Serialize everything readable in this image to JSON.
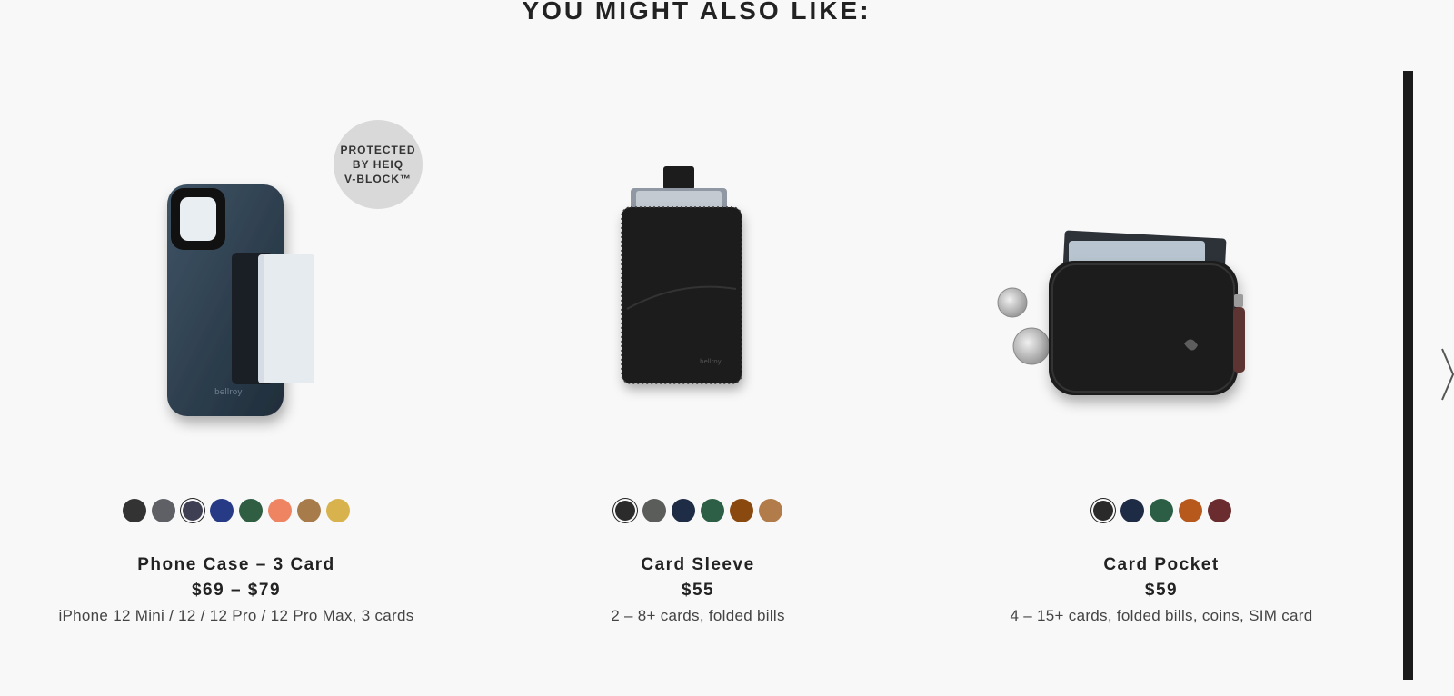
{
  "section": {
    "title": "YOU MIGHT ALSO LIKE:"
  },
  "products": [
    {
      "name": "Phone Case – 3 Card",
      "price": "$69 – $79",
      "description": "iPhone 12 Mini / 12 / 12 Pro / 12 Pro Max, 3 cards",
      "badge": "PROTECTED\nBY HEIQ\nV-BLOCK™",
      "swatches": [
        "#333333",
        "#5f6066",
        "#3e3f52",
        "#263a86",
        "#2f5e43",
        "#ee8462",
        "#a87c4a",
        "#d8b24d"
      ],
      "selected_swatch": 2
    },
    {
      "name": "Card Sleeve",
      "price": "$55",
      "description": "2 – 8+ cards, folded bills",
      "swatches": [
        "#2b2b2b",
        "#5b5d5a",
        "#1f2c45",
        "#2d5f46",
        "#8a4a0f",
        "#b17c49"
      ],
      "selected_swatch": 0
    },
    {
      "name": "Card Pocket",
      "price": "$59",
      "description": "4 – 15+ cards, folded bills, coins, SIM card",
      "swatches": [
        "#2a2a2a",
        "#1e2b45",
        "#2c5e46",
        "#b7591c",
        "#6a2c2e"
      ],
      "selected_swatch": 0
    }
  ],
  "icons": {
    "next": "chevron-right-icon"
  }
}
